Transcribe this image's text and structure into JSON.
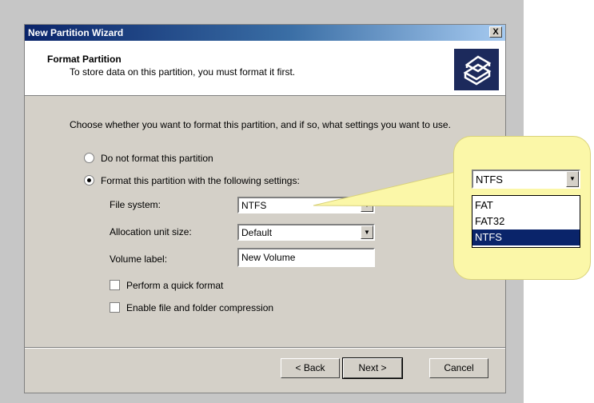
{
  "window": {
    "title": "New Partition Wizard",
    "close_glyph": "X",
    "header_title": "Format Partition",
    "header_subtitle": "To store data on this partition, you must format it first.",
    "header_icon": "disk-stack-icon"
  },
  "intro_text": "Choose whether you want to format this partition, and if so, what settings you want to use.",
  "options": {
    "do_not_format": "Do not format this partition",
    "format_with": "Format this partition with the following settings:",
    "selected": "format_with"
  },
  "settings": {
    "file_system_label": "File system:",
    "file_system_value": "NTFS",
    "allocation_label": "Allocation unit size:",
    "allocation_value": "Default",
    "volume_label": "Volume label:",
    "volume_value": "New Volume",
    "quick_format": "Perform a quick format",
    "compression": "Enable file and folder compression"
  },
  "buttons": {
    "back": "< Back",
    "next": "Next >",
    "cancel": "Cancel"
  },
  "callout": {
    "combo_value": "NTFS",
    "options": [
      "FAT",
      "FAT32",
      "NTFS"
    ],
    "selected_index": 2
  },
  "colors": {
    "titlebar": "#0a246a",
    "callout_bg": "#fbf7a8",
    "selection": "#0a246a"
  }
}
